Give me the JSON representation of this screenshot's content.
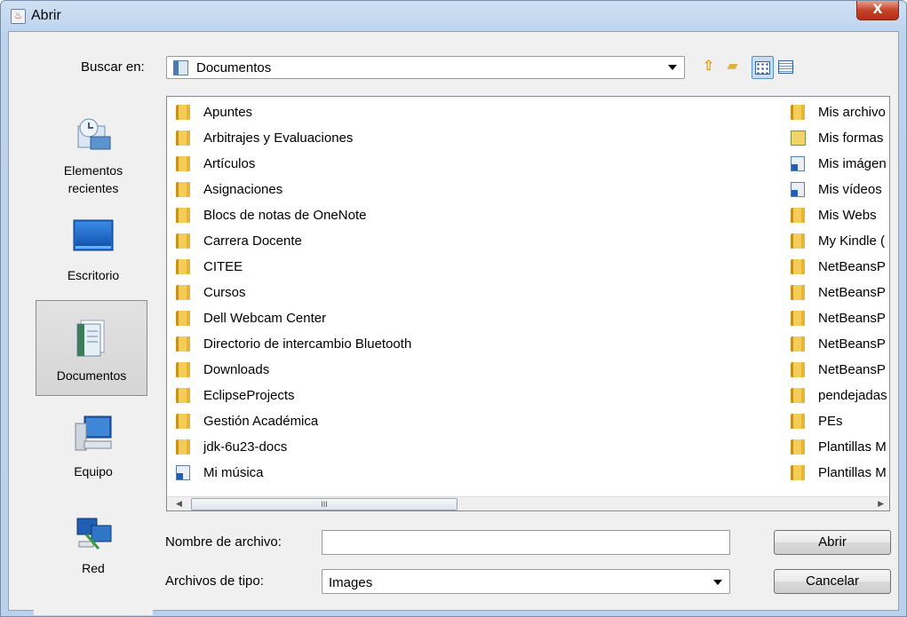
{
  "window": {
    "title": "Abrir",
    "close_glyph": "X"
  },
  "toolbar": {
    "look_in_label": "Buscar en:",
    "look_in_value": "Documentos",
    "icons": [
      "up-folder-icon",
      "new-folder-icon",
      "list-view-icon",
      "details-view-icon"
    ]
  },
  "places": [
    {
      "label_line1": "Elementos",
      "label_line2": "recientes",
      "icon": "recent-items-icon"
    },
    {
      "label_line1": "Escritorio",
      "icon": "desktop-icon"
    },
    {
      "label_line1": "Documentos",
      "icon": "documents-icon",
      "selected": true
    },
    {
      "label_line1": "Equipo",
      "icon": "computer-icon"
    },
    {
      "label_line1": "Red",
      "icon": "network-icon"
    }
  ],
  "files_col1": [
    {
      "name": "Apuntes",
      "type": "folder"
    },
    {
      "name": "Arbitrajes y Evaluaciones",
      "type": "folder"
    },
    {
      "name": "Artículos",
      "type": "folder"
    },
    {
      "name": "Asignaciones",
      "type": "folder"
    },
    {
      "name": "Blocs de notas de OneNote",
      "type": "folder"
    },
    {
      "name": "Carrera Docente",
      "type": "folder"
    },
    {
      "name": "CITEE",
      "type": "folder"
    },
    {
      "name": "Cursos",
      "type": "folder"
    },
    {
      "name": "Dell Webcam Center",
      "type": "folder"
    },
    {
      "name": "Directorio de intercambio Bluetooth",
      "type": "folder"
    },
    {
      "name": "Downloads",
      "type": "folder"
    },
    {
      "name": "EclipseProjects",
      "type": "folder"
    },
    {
      "name": "Gestión Académica",
      "type": "folder"
    },
    {
      "name": "jdk-6u23-docs",
      "type": "folder"
    },
    {
      "name": "Mi música",
      "type": "shortcut"
    }
  ],
  "files_col2": [
    {
      "name": "Mis archivo",
      "type": "folder"
    },
    {
      "name": "Mis formas",
      "type": "forms"
    },
    {
      "name": "Mis imágen",
      "type": "shortcut"
    },
    {
      "name": "Mis vídeos",
      "type": "shortcut"
    },
    {
      "name": "Mis Webs",
      "type": "folder"
    },
    {
      "name": "My Kindle (",
      "type": "folder"
    },
    {
      "name": "NetBeansP",
      "type": "folder"
    },
    {
      "name": "NetBeansP",
      "type": "folder"
    },
    {
      "name": "NetBeansP",
      "type": "folder"
    },
    {
      "name": "NetBeansP",
      "type": "folder"
    },
    {
      "name": "NetBeansP",
      "type": "folder"
    },
    {
      "name": "pendejadas",
      "type": "folder"
    },
    {
      "name": "PEs",
      "type": "folder"
    },
    {
      "name": "Plantillas M",
      "type": "folder"
    },
    {
      "name": "Plantillas M",
      "type": "folder"
    }
  ],
  "scrollbar": {
    "left_arrow": "◀",
    "right_arrow": "▶",
    "grip": "III"
  },
  "form": {
    "filename_label": "Nombre de archivo:",
    "filename_value": "",
    "filetype_label": "Archivos de tipo:",
    "filetype_value": "Images",
    "open_label": "Abrir",
    "cancel_label": "Cancelar"
  }
}
